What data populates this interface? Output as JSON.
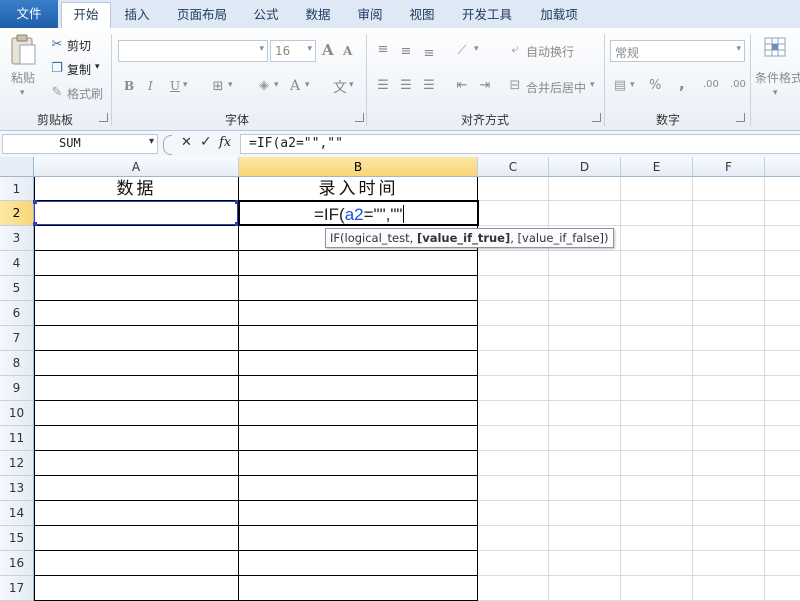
{
  "tabs": [
    "文件",
    "开始",
    "插入",
    "页面布局",
    "公式",
    "数据",
    "审阅",
    "视图",
    "开发工具",
    "加载项"
  ],
  "ribbon": {
    "clipboard": {
      "paste": "粘贴",
      "cut": "剪切",
      "copy": "复制",
      "format_painter": "格式刷",
      "group": "剪贴板"
    },
    "font": {
      "font_size": "16",
      "bold": "B",
      "italic": "I",
      "underline": "U",
      "grow": "A",
      "shrink": "A",
      "phonetic": "文",
      "color_a": "A",
      "group": "字体"
    },
    "alignment": {
      "wrap": "自动换行",
      "merge": "合并后居中",
      "group": "对齐方式"
    },
    "number": {
      "format": "常规",
      "percent": "%",
      "comma": ",",
      "inc_dec": ".00",
      "group": "数字"
    },
    "styles": {
      "conditional": "条件格式"
    }
  },
  "formula_bar": {
    "name_box": "SUM",
    "cancel": "✕",
    "enter": "✓",
    "fx": "fx",
    "formula": "=IF(a2=\"\",\"\""
  },
  "columns": [
    "A",
    "B",
    "C",
    "D",
    "E",
    "F"
  ],
  "rows": [
    "1",
    "2",
    "3",
    "4",
    "5",
    "6",
    "7",
    "8",
    "9",
    "10",
    "11",
    "12",
    "13",
    "14",
    "15",
    "16",
    "17"
  ],
  "cells": {
    "A1": "数据",
    "B1": "录入时间",
    "B2_prefix": "=IF(",
    "B2_ref": "a2",
    "B2_suffix": "=\"\",\"\""
  },
  "tooltip": {
    "p1": "IF(logical_test, ",
    "p2": "[value_if_true]",
    "p3": ", [value_if_false])"
  },
  "colors": {
    "ref_blue": "#1f4fd8",
    "file_tab": "#2a6db3",
    "header_selected": "#f9d575"
  }
}
